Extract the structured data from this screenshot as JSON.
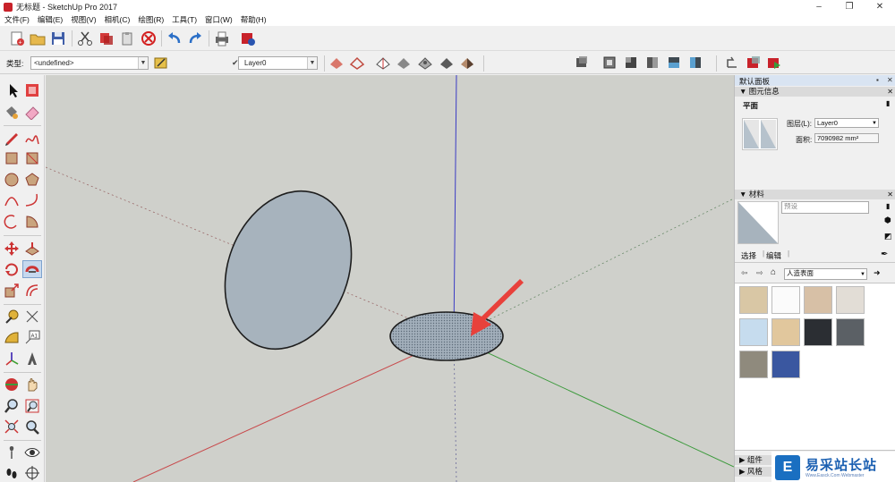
{
  "window": {
    "title": "无标题 - SketchUp Pro 2017",
    "minimize": "–",
    "maximize": "❐",
    "close": "✕"
  },
  "menu": [
    "文件(F)",
    "编辑(E)",
    "视图(V)",
    "相机(C)",
    "绘图(R)",
    "工具(T)",
    "窗口(W)",
    "帮助(H)"
  ],
  "styles_bar": {
    "type_label": "类型:",
    "type_value": "<undefined>",
    "layer_value": "Layer0"
  },
  "tray": {
    "title": "默认面板",
    "entity_info": {
      "header": "图元信息",
      "entity_type": "平面",
      "layer_label": "图层(L):",
      "layer_value": "Layer0",
      "area_label": "面积:",
      "area_value": "7090982 mm²"
    },
    "materials": {
      "header": "材料",
      "name_value": "预设",
      "tab_select": "选择",
      "tab_edit": "编辑",
      "collection_value": "人造表面",
      "swatches": [
        "#d9c7a5",
        "#fbfbfb",
        "#d7c0a6",
        "#e2ddd6",
        "#c6dcee",
        "#e1c79d",
        "#2b2e33",
        "#5b6065",
        "#8f8a7d",
        "#3a57a0"
      ]
    },
    "components_header": "组件",
    "styles_header": "风格"
  },
  "colors": {
    "viewport_bg": "#cfd0cb",
    "face_fill": "#a7b3bd",
    "axis_red": "#c8494b",
    "axis_green": "#3c9a3c",
    "axis_blue": "#3b3bc4",
    "arrow": "#e8413b"
  },
  "watermark": {
    "text": "易采站长站",
    "sub": "Www.Easck.Com Webmaster"
  }
}
